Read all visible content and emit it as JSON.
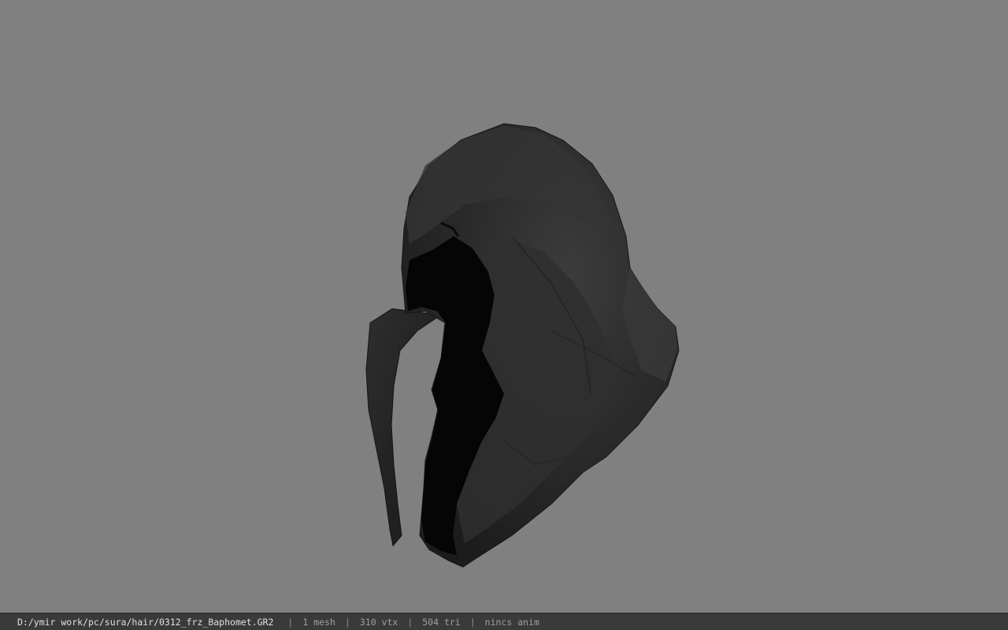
{
  "viewer": {
    "background_color": "#808080",
    "model_color": "#2b2b2b",
    "model_name": "hooded-mask-model"
  },
  "statusbar": {
    "file_path": "D:/ymir work/pc/sura/hair/0312_frz_Baphomet.GR2",
    "separator": "|",
    "mesh_count": "1 mesh",
    "vertex_count": "310 vtx",
    "triangle_count": "504 tri",
    "anim_status": "nincs anim"
  }
}
